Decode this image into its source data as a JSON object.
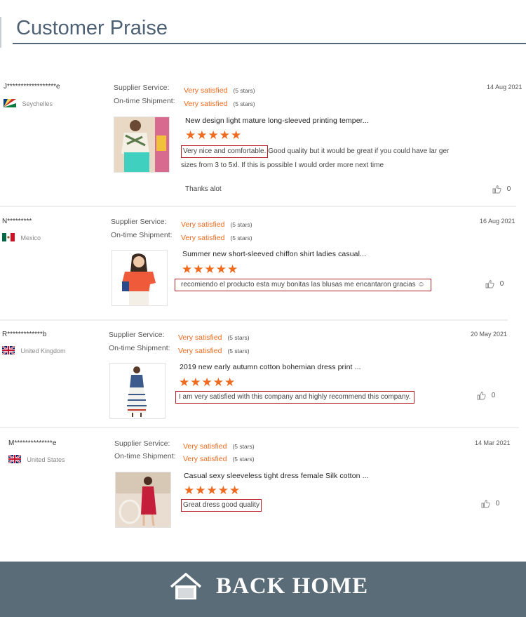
{
  "page": {
    "title": "Customer Praise"
  },
  "labels": {
    "supplier_service": "Supplier Service:",
    "ontime_shipment": "On-time Shipment:"
  },
  "reviews": [
    {
      "buyer": "J******************e",
      "country": "Seychelles",
      "supplier_service": "Very satisfied",
      "ontime_shipment": "Very satisfied",
      "stars_note": "(5 stars)",
      "rating": 5,
      "date": "14 Aug 2021",
      "product": "New design light mature long-sleeved printing temper...",
      "stars_text": "★★★★★",
      "review_highlight": "Very nice and comfortable.",
      "review_rest": "Good quality but it would be great if you could have lar ger sizes from 3 to 5xl. If this is possible I would order more next time",
      "reply": "Thanks alot",
      "likes": "0"
    },
    {
      "buyer": "N*********",
      "country": "Mexico",
      "supplier_service": "Very satisfied",
      "ontime_shipment": "Very satisfied",
      "stars_note": "(5 stars)",
      "rating": 5,
      "date": "16 Aug 2021",
      "product": "Summer new short-sleeved chiffon shirt ladies casual...",
      "stars_text": "★★★★★",
      "review_highlight": "recomiendo el producto esta muy bonitas las blusas me encantaron gracias ☺",
      "likes": "0"
    },
    {
      "buyer": "R*************b",
      "country": "United Kingdom",
      "supplier_service": "Very satisfied",
      "ontime_shipment": "Very satisfied",
      "stars_note": "(5 stars)",
      "rating": 5,
      "date": "20 May 2021",
      "product": "2019 new early autumn cotton bohemian dress print ...",
      "stars_text": "★★★★★",
      "review_highlight": "I am very satisfied with this company and highly recommend this company.",
      "likes": "0"
    },
    {
      "buyer": "M**************e",
      "country": "United States",
      "supplier_service": "Very satisfied",
      "ontime_shipment": "Very satisfied",
      "stars_note": "(5 stars)",
      "rating": 5,
      "date": "14 Mar 2021",
      "product": "Casual sexy sleeveless tight dress female Silk cotton ...",
      "stars_text": "★★★★★",
      "review_highlight": "Great dress good quality",
      "likes": "0"
    }
  ],
  "footer": {
    "back_home_label": "BACK HOME",
    "icon": "home-icon"
  },
  "colors": {
    "accent": "#ee6b1f",
    "title": "#4e6174",
    "footer_bg": "#5a6c78",
    "highlight_border": "#b5222a"
  }
}
